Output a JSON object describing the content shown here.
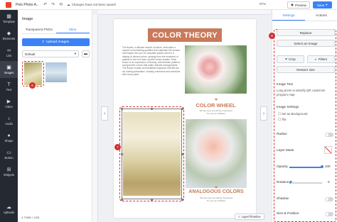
{
  "topbar": {
    "doc_title": "Pets Photo A...",
    "undo_icon": "undo-icon",
    "redo_icon": "redo-icon",
    "history_icon": "history-icon",
    "saved_status": "Changes have not been saved!",
    "zoom": "97%",
    "preview_label": "Preview",
    "save_label": "Save"
  },
  "rail": {
    "items": [
      {
        "label": "Template",
        "icon": "template-icon",
        "glyph": "▦"
      },
      {
        "label": "Elements",
        "icon": "elements-icon",
        "glyph": "◆"
      },
      {
        "label": "Link",
        "icon": "link-icon",
        "glyph": "🔗"
      },
      {
        "label": "Images",
        "icon": "image-icon",
        "glyph": "▣"
      },
      {
        "label": "Text",
        "icon": "text-icon",
        "glyph": "T"
      },
      {
        "label": "Video",
        "icon": "video-icon",
        "glyph": "▶"
      },
      {
        "label": "Audio",
        "icon": "audio-icon",
        "glyph": "♪"
      },
      {
        "label": "Shape",
        "icon": "shape-icon",
        "glyph": "●"
      },
      {
        "label": "Button",
        "icon": "button-icon",
        "glyph": "▭"
      },
      {
        "label": "Widgets",
        "icon": "widgets-icon",
        "glyph": "⊞"
      }
    ],
    "uploads_label": "Uploads",
    "uploads_glyph": "☁"
  },
  "images_panel": {
    "title": "Image",
    "tabs": [
      "Transparent PNGs",
      "Mine"
    ],
    "active_tab": "Mine",
    "upload_label": "Upload Images",
    "folder_value": "Default",
    "storage": "4.72MB / 1GB"
  },
  "badges": {
    "thumb": "6",
    "canvas": "7",
    "panel": "8"
  },
  "page": {
    "title": "COLOR THEORY",
    "paragraph": "The flower, a delicate marvel of nature, embodies a myriad of enchanting qualities that captivate the senses and inspire the soul. Its exquisite petals unfurl in a display of vibrant colors, ranging from the tenderest of pastels to the rich hues of jewel-toned shades. Each bloom is an expression of beauty, with intricate patterns and graceful curves that make delicate arrangements. The flower exudes an irresistible fragrance that fills the air, inviting admiration, evoking memories and emotions with every petal.",
    "color_wheel_title": "COLOR WHEEL",
    "color_wheel_sub": [
      "We are sure you will be impressed",
      "Try out our software"
    ],
    "analogous_title": "ANALOGOUS COLORS",
    "analogous_sub": [
      "We are sure you will be impressed",
      "Try out our software"
    ]
  },
  "layer_button": "Layer/Timeline",
  "settings_panel": {
    "tabs": [
      "Settings",
      "Actions"
    ],
    "active_tab": "Settings",
    "replace_label": "Replace",
    "select_image_label": "Select an Image",
    "crop_label": "Crop",
    "filters_label": "Filters",
    "restore_label": "Restore size",
    "image_text_label": "Image Text",
    "image_text_value": "Long press to identify QR code/mini program map",
    "image_settings_label": "Image Settings",
    "set_background_label": "Set as Background",
    "tile_label": "Tile",
    "radius_label": "Radius",
    "layer_mask_label": "Layer Mask",
    "opacity_label": "Opacity",
    "opacity_value": "100",
    "rotation_label": "Rotation",
    "rotation_value": "0",
    "shadow_label": "Shadow",
    "size_position_label": "Size & Position"
  }
}
